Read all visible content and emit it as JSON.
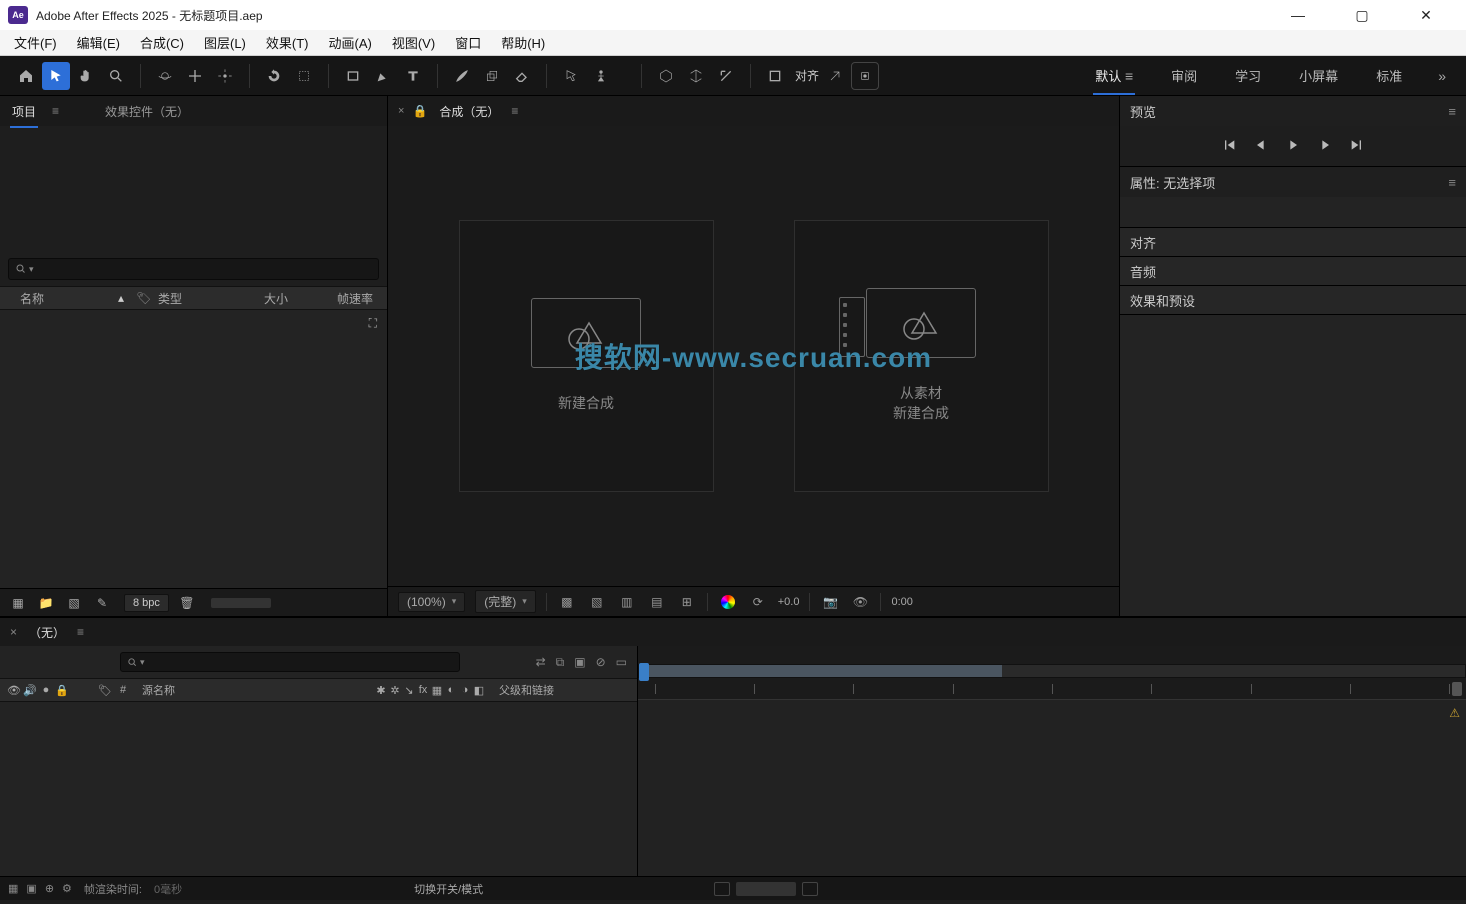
{
  "titlebar": {
    "badge": "Ae",
    "title": "Adobe After Effects 2025 - 无标题项目.aep"
  },
  "menubar": {
    "items": [
      "文件(F)",
      "编辑(E)",
      "合成(C)",
      "图层(L)",
      "效果(T)",
      "动画(A)",
      "视图(V)",
      "窗口",
      "帮助(H)"
    ]
  },
  "toolbar": {
    "snap_label": "对齐"
  },
  "workspaces": {
    "items": [
      "默认",
      "审阅",
      "学习",
      "小屏幕",
      "标准"
    ],
    "active_index": 0
  },
  "project_panel": {
    "tab_project": "项目",
    "tab_effect_controls": "效果控件（无）",
    "headers": {
      "name": "名称",
      "type": "类型",
      "size": "大小",
      "fps": "帧速率"
    },
    "bpc": "8 bpc"
  },
  "comp_panel": {
    "tab_label": "合成（无）",
    "card_new": "新建合成",
    "card_from_footage_l1": "从素材",
    "card_from_footage_l2": "新建合成",
    "watermark": "搜软网-www.secruan.com",
    "zoom": "(100%)",
    "resolution": "(完整)",
    "exposure": "+0.0",
    "timecode": "0:00"
  },
  "right_panels": {
    "preview": "预览",
    "properties": "属性: 无选择项",
    "align": "对齐",
    "audio": "音频",
    "effects_presets": "效果和预设"
  },
  "timeline": {
    "tab": "（无）",
    "header_source": "源名称",
    "header_parent": "父级和链接"
  },
  "statusbar": {
    "render_time_label": "帧渲染时间:",
    "render_time_value": "0毫秒",
    "switch_label": "切换开关/模式"
  }
}
